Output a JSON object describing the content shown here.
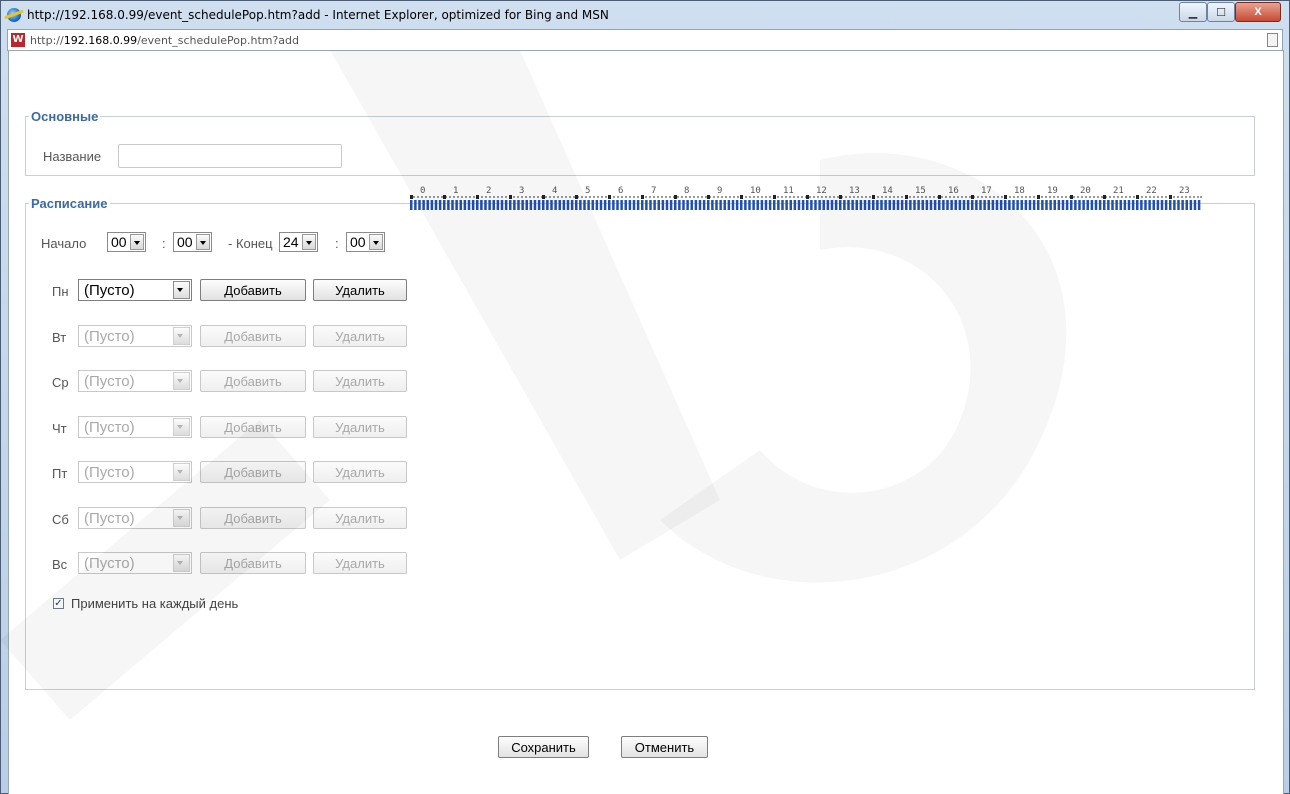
{
  "window": {
    "title": "http://192.168.0.99/event_schedulePop.htm?add - Internet Explorer, optimized for Bing and MSN",
    "controls": {
      "minimize": "▁",
      "maximize": "☐",
      "close": "X"
    }
  },
  "address": {
    "prefix": "http://",
    "host": "192.168.0.99",
    "path": "/event_schedulePop.htm?add",
    "site_icon": "W"
  },
  "basic": {
    "legend": "Основные",
    "name_label": "Название",
    "name_value": ""
  },
  "schedule": {
    "legend": "Расписание",
    "start_label": "Начало",
    "start_hour": "00",
    "start_min": "00",
    "colon": ":",
    "end_label": "- Конец",
    "end_hour": "24",
    "end_min": "00",
    "days": [
      {
        "label": "Пн",
        "value": "(Пусто)",
        "add": "Добавить",
        "remove": "Удалить",
        "enabled": true
      },
      {
        "label": "Вт",
        "value": "(Пусто)",
        "add": "Добавить",
        "remove": "Удалить",
        "enabled": false
      },
      {
        "label": "Ср",
        "value": "(Пусто)",
        "add": "Добавить",
        "remove": "Удалить",
        "enabled": false
      },
      {
        "label": "Чт",
        "value": "(Пусто)",
        "add": "Добавить",
        "remove": "Удалить",
        "enabled": false
      },
      {
        "label": "Пт",
        "value": "(Пусто)",
        "add": "Добавить",
        "remove": "Удалить",
        "enabled": false
      },
      {
        "label": "Сб",
        "value": "(Пусто)",
        "add": "Добавить",
        "remove": "Удалить",
        "enabled": false
      },
      {
        "label": "Вс",
        "value": "(Пусто)",
        "add": "Добавить",
        "remove": "Удалить",
        "enabled": false
      }
    ],
    "hours": [
      "0",
      "1",
      "2",
      "3",
      "4",
      "5",
      "6",
      "7",
      "8",
      "9",
      "10",
      "11",
      "12",
      "13",
      "14",
      "15",
      "16",
      "17",
      "18",
      "19",
      "20",
      "21",
      "22",
      "23"
    ],
    "active_range": [
      0,
      24
    ],
    "apply_every_day_label": "Применить на каждый день",
    "apply_every_day": true
  },
  "footer": {
    "save": "Сохранить",
    "cancel": "Отменить"
  },
  "colors": {
    "legend": "#3b6aa8",
    "timeline_bar": "#1f4fb4"
  }
}
